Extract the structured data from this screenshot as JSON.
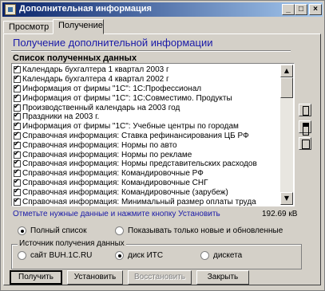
{
  "window": {
    "title": "Дополнительная информация"
  },
  "titlebar_buttons": {
    "minimize": "_",
    "maximize": "□",
    "close": "×"
  },
  "tabs": [
    {
      "label": "Просмотр",
      "active": false
    },
    {
      "label": "Получение",
      "active": true
    }
  ],
  "main": {
    "heading": "Получение дополнительной информации",
    "list_label": "Список полученных данных",
    "items": [
      {
        "label": "Календарь бухгалтера 1 квартал 2003 г",
        "checked": true
      },
      {
        "label": "Календарь бухгалтера 4 квартал 2002 г",
        "checked": true
      },
      {
        "label": "Информация от фирмы \"1С\": 1С:Профессионал",
        "checked": true
      },
      {
        "label": "Информация от фирмы \"1С\": 1С:Совместимо. Продукты",
        "checked": true
      },
      {
        "label": "Производственный календарь на 2003 год",
        "checked": true
      },
      {
        "label": "Праздники на 2003 г.",
        "checked": true
      },
      {
        "label": "Информация от фирмы \"1С\": Учебные центры по городам",
        "checked": true
      },
      {
        "label": "Справочная информация: Ставка рефинансирования ЦБ РФ",
        "checked": true
      },
      {
        "label": "Справочная информация: Нормы по авто",
        "checked": true
      },
      {
        "label": "Справочная информация: Нормы по рекламе",
        "checked": true
      },
      {
        "label": "Справочная информация: Нормы представительских расходов",
        "checked": true
      },
      {
        "label": "Справочная информация: Командировочные РФ",
        "checked": true
      },
      {
        "label": "Справочная информация: Командировочные СНГ",
        "checked": true
      },
      {
        "label": "Справочная информация: Командировочные (зарубеж)",
        "checked": true
      },
      {
        "label": "Справочная информация: Минимальный размер оплаты труда",
        "checked": true
      }
    ],
    "hint": "Отметьте нужные данные и нажмите кнопку Установить",
    "size": "192.69 кВ",
    "scroll_up": "▲",
    "scroll_down": "▼"
  },
  "view_options": {
    "full_list": {
      "label": "Полный список",
      "selected": true
    },
    "new_only": {
      "label": "Показывать только новые и обновленные",
      "selected": false
    }
  },
  "source": {
    "title": "Источник получения данных",
    "options": [
      {
        "label": "сайт BUH.1C.RU",
        "selected": false
      },
      {
        "label": "диск ИТС",
        "selected": true
      },
      {
        "label": "дискета",
        "selected": false
      }
    ]
  },
  "buttons": {
    "get": "Получить",
    "install": "Установить",
    "restore": "Восстановить",
    "close": "Закрыть"
  }
}
